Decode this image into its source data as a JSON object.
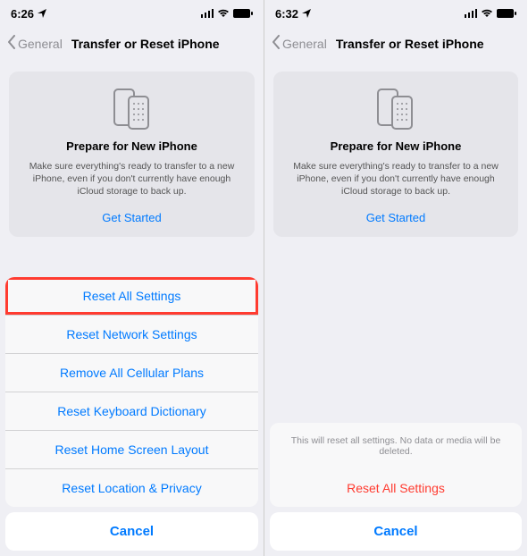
{
  "left": {
    "time": "6:26",
    "back_label": "General",
    "nav_title": "Transfer or Reset iPhone",
    "prepare": {
      "title": "Prepare for New iPhone",
      "desc": "Make sure everything's ready to transfer to a new iPhone, even if you don't currently have enough iCloud storage to back up.",
      "get_started": "Get Started"
    },
    "sheet": {
      "items": [
        "Reset All Settings",
        "Reset Network Settings",
        "Remove All Cellular Plans",
        "Reset Keyboard Dictionary",
        "Reset Home Screen Layout",
        "Reset Location & Privacy"
      ],
      "cancel": "Cancel"
    }
  },
  "right": {
    "time": "6:32",
    "back_label": "General",
    "nav_title": "Transfer or Reset iPhone",
    "prepare": {
      "title": "Prepare for New iPhone",
      "desc": "Make sure everything's ready to transfer to a new iPhone, even if you don't currently have enough iCloud storage to back up.",
      "get_started": "Get Started"
    },
    "confirm": {
      "message": "This will reset all settings. No data or media will be deleted.",
      "destructive": "Reset All Settings",
      "cancel": "Cancel"
    }
  }
}
